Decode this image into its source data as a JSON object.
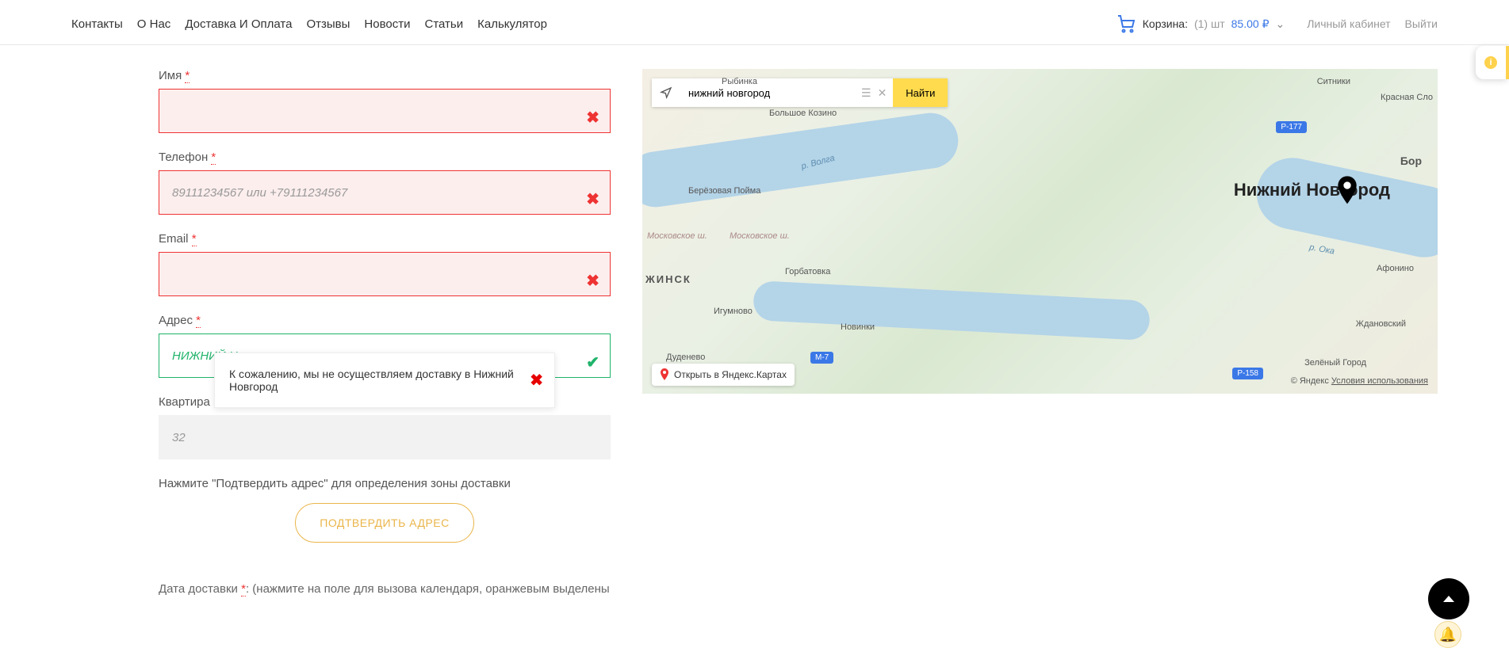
{
  "nav": {
    "items": [
      "Контакты",
      "О Нас",
      "Доставка И Оплата",
      "Отзывы",
      "Новости",
      "Статьи",
      "Калькулятор"
    ]
  },
  "cart": {
    "label": "Корзина:",
    "count": "(1) шт",
    "price": "85.00 ₽"
  },
  "user": {
    "account": "Личный кабинет",
    "logout": "Выйти"
  },
  "form": {
    "name_label": "Имя",
    "phone_label": "Телефон",
    "phone_placeholder": "89111234567 или +79111234567",
    "email_label": "Email",
    "address_label": "Адрес",
    "address_value": "НИЖНИЙ Н",
    "apartment_label": "Квартира",
    "apartment_placeholder": "32",
    "hint": "Нажмите \"Подтвердить адрес\" для определения зоны доставки",
    "confirm_btn": "ПОДТВЕРДИТЬ АДРЕС",
    "date_label": "Дата доставки ",
    "date_note": ": (нажмите на поле для вызова календаря, оранжевым выделены"
  },
  "popover": {
    "text": "К сожалению, мы не осуществляем доставку в Нижний Новгород"
  },
  "map": {
    "search_value": "нижний новгород",
    "find": "Найти",
    "main_city": "Нижний Новгород",
    "labels": {
      "rybinka": "Рыбинка",
      "sitniki": "Ситники",
      "b_kozino": "Большое Козино",
      "kr_slo": "Красная Сло",
      "bor": "Бор",
      "b_poyma": "Берёзовая Пойма",
      "mosk": "Московское ш.",
      "mosk2": "Московское ш.",
      "gorbatovka": "Горбатовка",
      "afonino": "Афонино",
      "igumnovo": "Игумново",
      "novinki": "Новинки",
      "zhdan": "Ждановский",
      "dudnevo": "Дуденево",
      "zel_gorod": "Зелёный Город",
      "zhinsk": "ЖИНСК",
      "volga": "р. Волга",
      "oka": "р. Ока"
    },
    "roads": {
      "r177": "Р-177",
      "m7": "М-7",
      "r158": "Р-158"
    },
    "open_in": "Открыть в Яндекс.Картах",
    "copyright": "© Яндекс",
    "terms": "Условия использования"
  },
  "side_notif": "i"
}
